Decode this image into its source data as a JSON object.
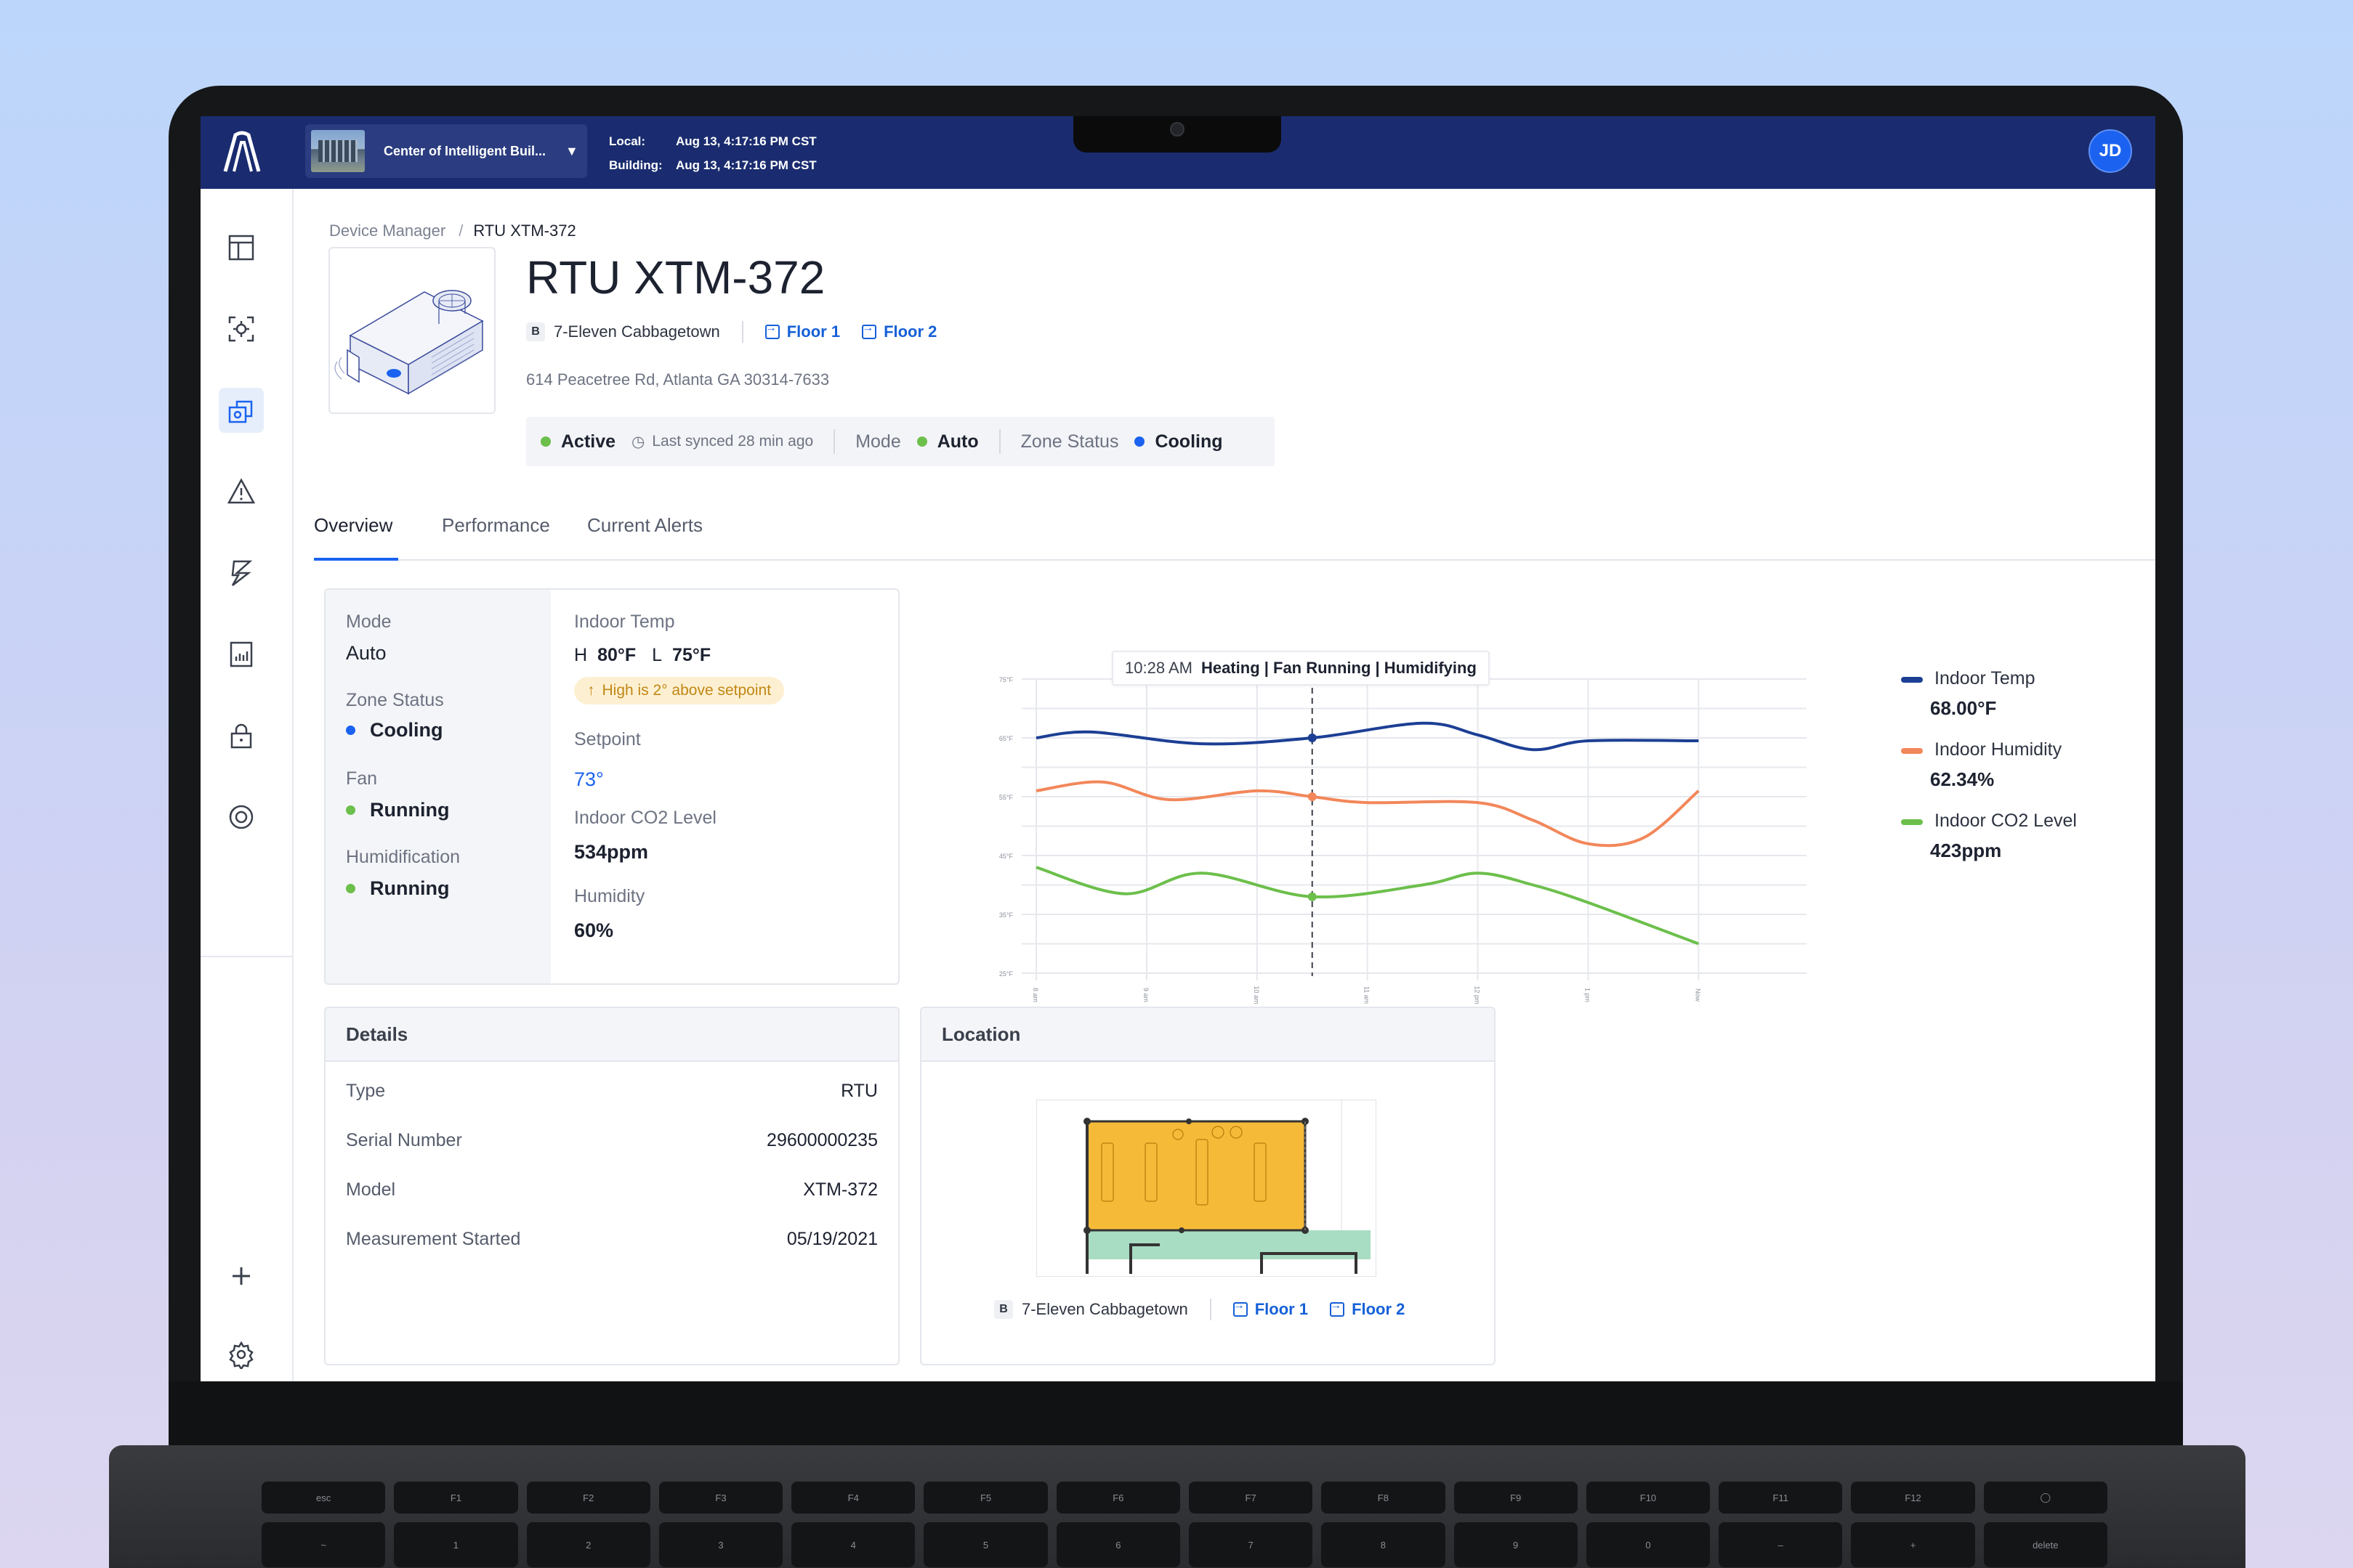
{
  "header": {
    "building_name": "Center of Intelligent Buil...",
    "local_label": "Local:",
    "local_time": "Aug 13, 4:17:16 PM CST",
    "building_label": "Building:",
    "building_time": "Aug 13, 4:17:16 PM CST",
    "avatar_initials": "JD"
  },
  "sidebar": {
    "items": [
      "dashboard-icon",
      "camera-scan-icon",
      "device-manager-icon",
      "alert-icon",
      "energy-icon",
      "report-icon",
      "lock-icon",
      "target-icon"
    ],
    "bottom": [
      "plus-icon",
      "gear-icon",
      "chat-icon"
    ],
    "active_index": 2
  },
  "breadcrumb": {
    "parent": "Device Manager",
    "separator": "/",
    "current": "RTU XTM-372"
  },
  "device": {
    "title": "RTU XTM-372",
    "building_badge": "B",
    "building": "7-Eleven Cabbagetown",
    "floor1": "Floor 1",
    "floor2": "Floor 2",
    "address": "614 Peacetree Rd, Atlanta GA 30314-7633",
    "status": "Active",
    "last_synced": "Last synced 28 min ago",
    "mode_label": "Mode",
    "mode_value": "Auto",
    "zone_label": "Zone Status",
    "zone_value": "Cooling"
  },
  "tabs": [
    "Overview",
    "Performance",
    "Current Alerts"
  ],
  "overview": {
    "mode_label": "Mode",
    "mode_value": "Auto",
    "zone_label": "Zone Status",
    "zone_value": "Cooling",
    "fan_label": "Fan",
    "fan_value": "Running",
    "humid_label": "Humidification",
    "humid_value": "Running",
    "indoor_temp_label": "Indoor Temp",
    "high_prefix": "H",
    "high_value": "80°F",
    "low_prefix": "L",
    "low_value": "75°F",
    "warning": "High is 2° above setpoint",
    "setpoint_label": "Setpoint",
    "setpoint_value": "73°",
    "co2_label": "Indoor CO2 Level",
    "co2_value": "534ppm",
    "humidity_label": "Humidity",
    "humidity_value": "60%"
  },
  "chart_tooltip": {
    "time": "10:28 AM",
    "text": "Heating | Fan Running | Humidifying"
  },
  "chart_data": {
    "type": "line",
    "x": [
      "8 am",
      "9 am",
      "10 am",
      "11 am",
      "12 pm",
      "1 pm",
      "Now"
    ],
    "ytick_labels": [
      "25°F",
      "35°F",
      "45°F",
      "55°F",
      "65°F",
      "75°F"
    ],
    "ylim": [
      25,
      75
    ],
    "grid": true,
    "series": [
      {
        "name": "Indoor Temp",
        "color": "#1c3f94",
        "points": [
          [
            0,
            65
          ],
          [
            0.5,
            66
          ],
          [
            1.5,
            64
          ],
          [
            2.5,
            65
          ],
          [
            3.5,
            67.5
          ],
          [
            4,
            65.5
          ],
          [
            4.5,
            63
          ],
          [
            5,
            64.5
          ],
          [
            6,
            64.5
          ]
        ]
      },
      {
        "name": "Indoor Humidity",
        "color": "#f2875a",
        "points": [
          [
            0,
            56
          ],
          [
            0.6,
            57.5
          ],
          [
            1.2,
            54.5
          ],
          [
            2,
            56
          ],
          [
            2.5,
            55
          ],
          [
            3,
            54
          ],
          [
            4,
            54
          ],
          [
            4.5,
            51
          ],
          [
            5,
            47
          ],
          [
            5.5,
            48
          ],
          [
            6,
            56
          ]
        ]
      },
      {
        "name": "Indoor CO2 Level",
        "color": "#6cbf4b",
        "points": [
          [
            0,
            43
          ],
          [
            0.8,
            38.5
          ],
          [
            1.5,
            42
          ],
          [
            2.5,
            38
          ],
          [
            3.5,
            40
          ],
          [
            4,
            42
          ],
          [
            4.5,
            40
          ],
          [
            5,
            37
          ],
          [
            6,
            30
          ]
        ]
      }
    ],
    "legend": [
      {
        "name": "Indoor Temp",
        "value": "68.00°F",
        "color": "#1c3f94"
      },
      {
        "name": "Indoor Humidity",
        "value": "62.34%",
        "color": "#f2875a"
      },
      {
        "name": "Indoor CO2 Level",
        "value": "423ppm",
        "color": "#6cbf4b"
      }
    ],
    "legend_position": "right"
  },
  "details": {
    "title": "Details",
    "rows": [
      {
        "k": "Type",
        "v": "RTU"
      },
      {
        "k": "Serial Number",
        "v": "29600000235"
      },
      {
        "k": "Model",
        "v": "XTM-372"
      },
      {
        "k": "Measurement Started",
        "v": "05/19/2021"
      }
    ]
  },
  "location": {
    "title": "Location",
    "badge": "B",
    "building": "7-Eleven Cabbagetown",
    "floor1": "Floor 1",
    "floor2": "Floor 2"
  },
  "colors": {
    "navy": "#1a2c6f",
    "accent": "#1b62f0",
    "active": "#6cbf4b",
    "zone": "#f5b324",
    "corridor": "#a8dcc3"
  }
}
